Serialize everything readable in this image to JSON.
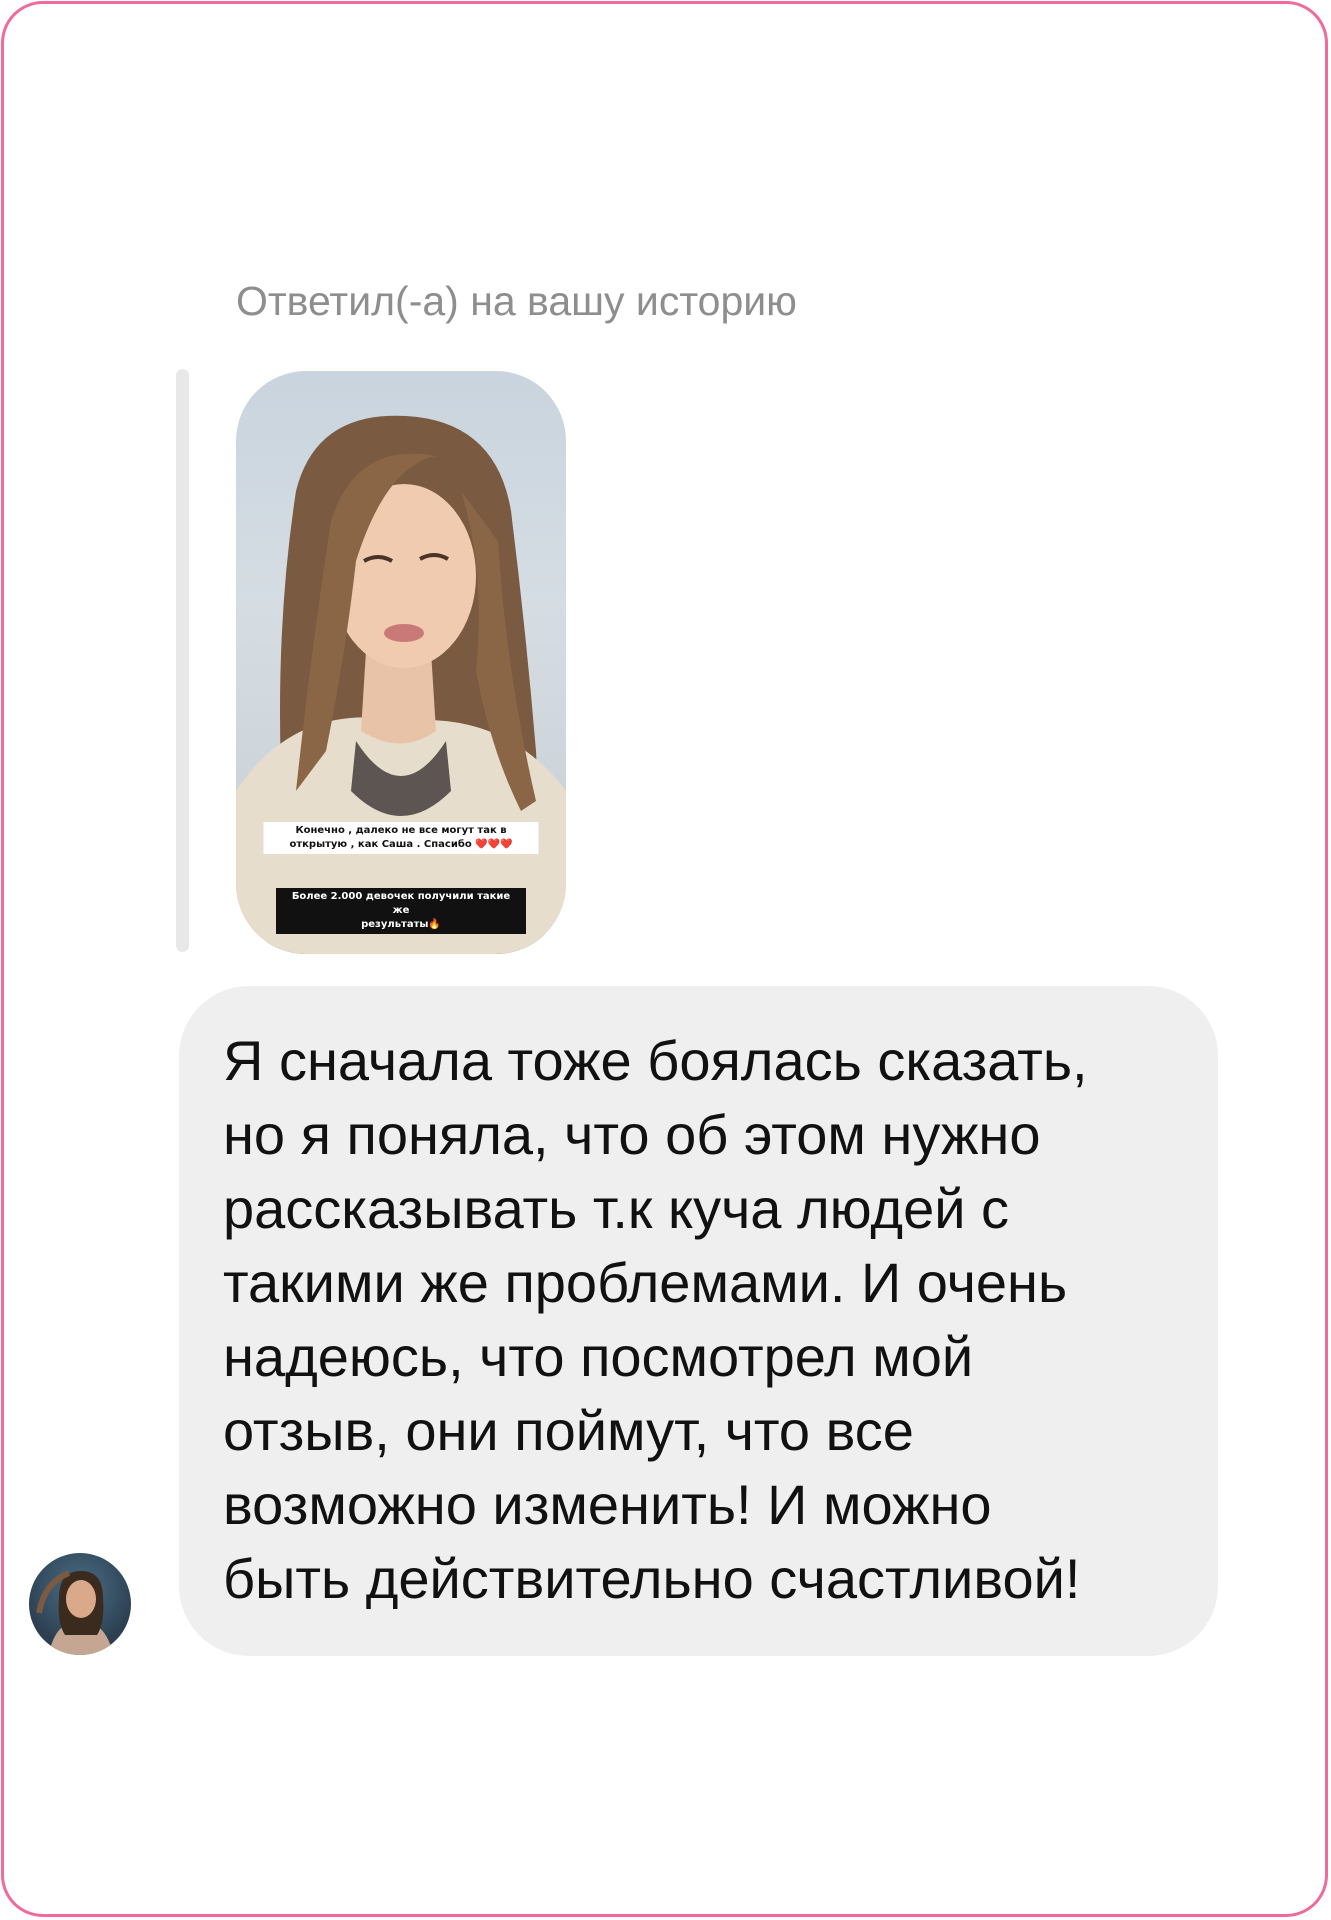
{
  "reply_header": "Ответил(-а) на вашу историю",
  "story": {
    "caption_1": "Конечно , далеко не все могут так в\nоткрытую , как Саша . Спасибо ❤️❤️❤️",
    "caption_2": "Более 2.000 девочек получили такие же\nрезультаты🔥"
  },
  "message": {
    "text": "Я сначала тоже боялась сказать,\nно я поняла, что об этом нужно\nрассказывать т.к куча людей с\nтакими же проблемами. И очень\nнадеюсь, что посмотрел мой\nотзыв, они поймут, что все\nвозможно изменить! И можно\nбыть действительно счастливой!"
  },
  "colors": {
    "frame_border": "#f06a9b",
    "bubble_bg": "#efefef",
    "header_text": "#8e8e8e"
  }
}
